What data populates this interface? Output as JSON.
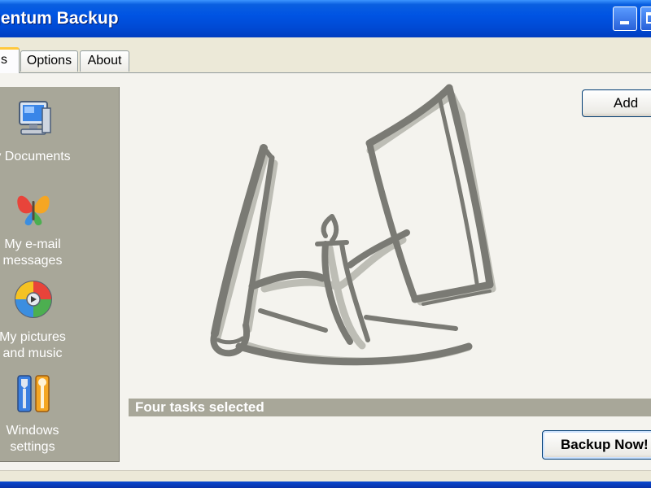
{
  "window": {
    "title": "Argentum Backup",
    "title_visible": "gentum Backup"
  },
  "tabs": [
    {
      "label": "s",
      "full_label": "Tasks",
      "active": true
    },
    {
      "label": "Options",
      "active": false
    },
    {
      "label": "About",
      "active": false
    }
  ],
  "sidebar": {
    "items": [
      {
        "label": "y Documents",
        "icon": "computer-icon"
      },
      {
        "label": "My e-mail\nmessages",
        "icon": "butterfly-icon"
      },
      {
        "label": "My pictures\nand music",
        "icon": "media-disc-icon"
      },
      {
        "label": "Windows\nsettings",
        "icon": "tools-icon"
      }
    ]
  },
  "main": {
    "add_label": "Add",
    "status_text": "Four tasks selected",
    "backup_label": "Backup Now!"
  },
  "colors": {
    "titlebar": "#0054e3",
    "sidebar": "#a8a799",
    "panel": "#f4f3ee",
    "accent_tab": "#ffc83c"
  }
}
